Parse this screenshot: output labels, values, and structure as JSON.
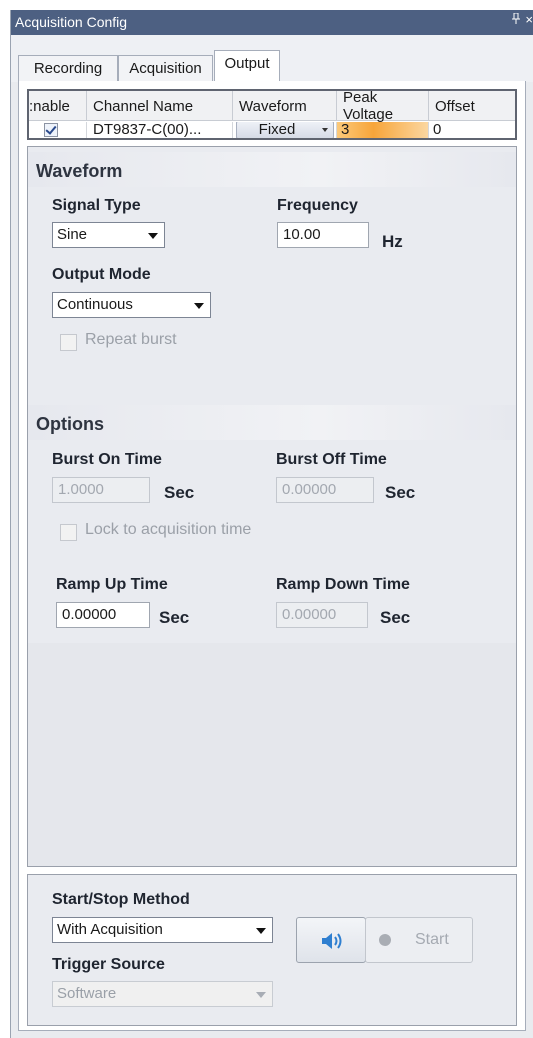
{
  "window": {
    "title": "Acquisition Config",
    "pin_glyph": "Ȩ",
    "close_glyph": "×"
  },
  "tabs": [
    {
      "label": "Recording",
      "active": false
    },
    {
      "label": "Acquisition",
      "active": false
    },
    {
      "label": "Output",
      "active": true
    }
  ],
  "grid": {
    "headers": {
      "enable": ":nable",
      "channel_name": "Channel Name",
      "waveform": "Waveform",
      "peak_voltage_1": "Peak",
      "peak_voltage_2": "Voltage",
      "offset": "Offset"
    },
    "rows": [
      {
        "enabled": true,
        "channel_name": "DT9837-C(00)...",
        "waveform": "Fixed",
        "peak_voltage": "3",
        "offset": "0"
      }
    ]
  },
  "waveform_section": {
    "title": "Waveform",
    "signal_type_label": "Signal Type",
    "signal_type_value": "Sine",
    "frequency_label": "Frequency",
    "frequency_value": "10.00",
    "frequency_unit": "Hz",
    "output_mode_label": "Output Mode",
    "output_mode_value": "Continuous",
    "repeat_burst_label": "Repeat burst",
    "repeat_burst_checked": false
  },
  "options_section": {
    "title": "Options",
    "burst_on_time_label": "Burst On Time",
    "burst_on_time_value": "1.0000",
    "burst_off_time_label": "Burst Off Time",
    "burst_off_time_value": "0.00000",
    "sec_unit": "Sec",
    "lock_label": "Lock to acquisition time",
    "lock_checked": false,
    "ramp_up_label": "Ramp Up Time",
    "ramp_up_value": "0.00000",
    "ramp_down_label": "Ramp Down Time",
    "ramp_down_value": "0.00000"
  },
  "bottom": {
    "start_stop_label": "Start/Stop Method",
    "start_stop_value": "With Acquisition",
    "trigger_source_label": "Trigger Source",
    "trigger_source_value": "Software",
    "start_label": "Start",
    "speaker_icon": "speaker-icon"
  },
  "colors": {
    "titlebar": "#4d6082",
    "peak_highlight": "#f7a53a",
    "speaker_blue": "#2f7fd0"
  }
}
